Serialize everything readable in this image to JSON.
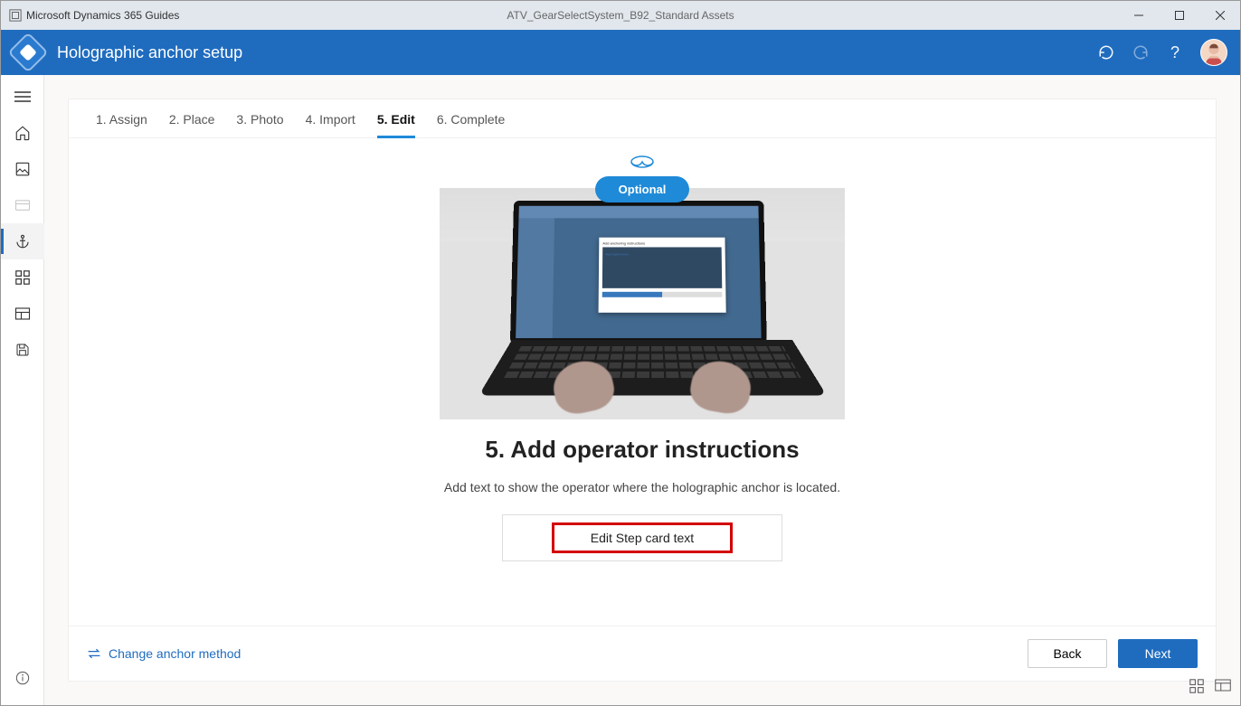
{
  "titlebar": {
    "app_name": "Microsoft Dynamics 365 Guides",
    "document_name": "ATV_GearSelectSystem_B92_Standard Assets"
  },
  "header": {
    "title": "Holographic anchor setup"
  },
  "tabs": [
    {
      "label": "1. Assign"
    },
    {
      "label": "2. Place"
    },
    {
      "label": "3. Photo"
    },
    {
      "label": "4. Import"
    },
    {
      "label": "5. Edit"
    },
    {
      "label": "6. Complete"
    }
  ],
  "badge": {
    "label": "Optional"
  },
  "dialog_preview": {
    "title": "Add anchoring instructions",
    "subtitle": "Align Digital Anchor"
  },
  "step": {
    "heading": "5. Add operator instructions",
    "description": "Add text to show the operator where the holographic anchor is located.",
    "button_label": "Edit Step card text"
  },
  "footer": {
    "change_method": "Change anchor method",
    "back": "Back",
    "next": "Next"
  }
}
